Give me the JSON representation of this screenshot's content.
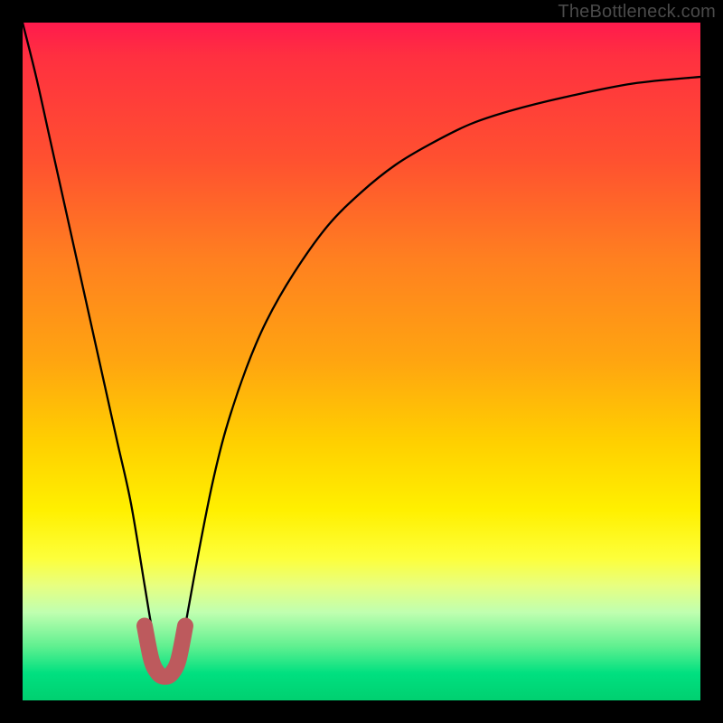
{
  "watermark": "TheBottleneck.com",
  "chart_data": {
    "type": "line",
    "title": "",
    "xlabel": "",
    "ylabel": "",
    "xlim": [
      0,
      100
    ],
    "ylim": [
      0,
      100
    ],
    "grid": false,
    "legend": false,
    "series": [
      {
        "name": "main-curve",
        "color": "#000000",
        "x": [
          0,
          2,
          4,
          6,
          8,
          10,
          12,
          14,
          16,
          18,
          19,
          20,
          21,
          22,
          23,
          24,
          26,
          28,
          30,
          33,
          36,
          40,
          45,
          50,
          55,
          60,
          66,
          72,
          80,
          90,
          100
        ],
        "y": [
          100,
          92,
          83,
          74,
          65,
          56,
          47,
          38,
          29,
          17,
          11,
          6,
          4,
          4,
          6,
          11,
          22,
          32,
          40,
          49,
          56,
          63,
          70,
          75,
          79,
          82,
          85,
          87,
          89,
          91,
          92
        ]
      },
      {
        "name": "highlight-segment",
        "color": "#c05a5a",
        "x": [
          18,
          19,
          20,
          21,
          22,
          23,
          24
        ],
        "y": [
          11,
          6,
          4,
          3.5,
          4,
          6,
          11
        ],
        "note": "thick rounded stroke near curve minimum"
      }
    ],
    "background": {
      "type": "vertical-gradient",
      "stops": [
        {
          "pos": 0,
          "color": "#ff1a4d"
        },
        {
          "pos": 50,
          "color": "#ffa510"
        },
        {
          "pos": 78,
          "color": "#fdff3a"
        },
        {
          "pos": 100,
          "color": "#00d070"
        }
      ]
    }
  }
}
